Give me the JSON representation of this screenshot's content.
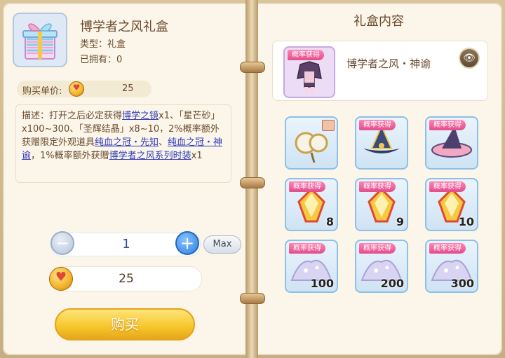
{
  "item": {
    "title": "博学者之风礼盒",
    "type_label": "类型：礼盒",
    "owned_label": "已拥有：0"
  },
  "price": {
    "label": "购买单价:",
    "value": "25"
  },
  "description": {
    "prefix": "描述：打开之后必定获得",
    "link1": "博学之镜",
    "mid1": "x1、「星芒砂」x100~300、「圣辉结晶」x8~10，2%概率额外获赠限定外观道具",
    "link2": "纯血之冠・先知",
    "mid2": "、",
    "link3": "纯血之冠・神谕",
    "mid3": "，1%概率额外获赠",
    "link4": "博学者之风系列时装",
    "suffix": "x1"
  },
  "purchase": {
    "quantity": "1",
    "max_label": "Max",
    "total": "25",
    "buy_label": "购买"
  },
  "right": {
    "title": "礼盒内容",
    "featured_name": "博学者之风・神谕",
    "featured_badge": "概率获得"
  },
  "tiles": [
    {
      "kind": "mirror",
      "badge": "",
      "count": ""
    },
    {
      "kind": "hat-blue",
      "badge": "概率获得",
      "count": ""
    },
    {
      "kind": "hat-pink",
      "badge": "概率获得",
      "count": ""
    },
    {
      "kind": "crystal",
      "badge": "概率获得",
      "count": "8"
    },
    {
      "kind": "crystal",
      "badge": "概率获得",
      "count": "9"
    },
    {
      "kind": "crystal",
      "badge": "概率获得",
      "count": "10"
    },
    {
      "kind": "sand",
      "badge": "概率获得",
      "count": "100"
    },
    {
      "kind": "sand",
      "badge": "概率获得",
      "count": "200"
    },
    {
      "kind": "sand",
      "badge": "概率获得",
      "count": "300"
    }
  ],
  "colors": {
    "text_brown": "#6b4a2e",
    "link_blue": "#2f3bb8",
    "badge_pink": "#e14c8b",
    "buy_yellow": "#f6c52a",
    "tile_border": "#8cc0e6"
  }
}
